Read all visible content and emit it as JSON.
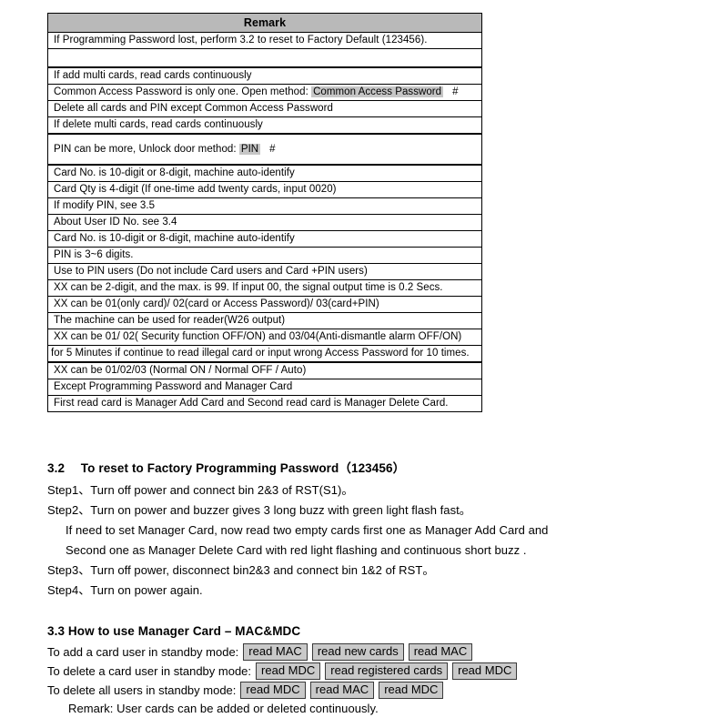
{
  "table": {
    "header": "Remark",
    "rows": [
      {
        "kind": "text",
        "text": "If Programming Password lost, perform 3.2 to reset to Factory Default (123456)."
      },
      {
        "kind": "empty",
        "text": ""
      },
      {
        "kind": "text",
        "text": "If add multi cards, read cards continuously",
        "group_start": true
      },
      {
        "kind": "highlight",
        "prefix": "Common Access Password is only one.  Open method: ",
        "highlight": "Common Access Password",
        "suffix": "#"
      },
      {
        "kind": "text",
        "text": "Delete all cards and PIN except Common Access Password"
      },
      {
        "kind": "text",
        "text": "If delete multi cards, read cards continuously",
        "group_end": true
      },
      {
        "kind": "highlight",
        "prefix": "PIN can be more, Unlock door method: ",
        "highlight": "PIN",
        "suffix": "#",
        "tall": true
      },
      {
        "kind": "text",
        "text": "Card No. is 10-digit or 8-digit, machine auto-identify",
        "group_start": true
      },
      {
        "kind": "text",
        "text": "Card Qty is 4-digit (If one-time add twenty cards, input 0020)"
      },
      {
        "kind": "text",
        "text": "If modify PIN, see 3.5"
      },
      {
        "kind": "text",
        "text": "About User ID No. see 3.4"
      },
      {
        "kind": "text",
        "text": "Card No. is 10-digit or 8-digit, machine auto-identify"
      },
      {
        "kind": "text",
        "text": "PIN is 3~6 digits."
      },
      {
        "kind": "text",
        "text": "Use to PIN users (Do not include Card users and Card +PIN users)"
      },
      {
        "kind": "text",
        "text": "XX can be 2-digit, and the max. is 99. If input 00, the signal output time is 0.2 Secs."
      },
      {
        "kind": "text",
        "text": "XX can be 01(only card)/ 02(card or Access Password)/ 03(card+PIN)"
      },
      {
        "kind": "text",
        "text": "The machine can be used for reader(W26 output)"
      },
      {
        "kind": "text",
        "text": "XX can be 01/ 02( Security function OFF/ON) and 03/04(Anti-dismantle alarm OFF/ON)"
      },
      {
        "kind": "flush",
        "text": "for 5 Minutes if continue to read illegal card or input wrong Access Password for 10 times."
      },
      {
        "kind": "text",
        "text": "XX can be 01/02/03  (Normal ON    / Normal OFF /    Auto)",
        "group_start": true
      },
      {
        "kind": "text",
        "text": "Except Programming Password and Manager Card"
      },
      {
        "kind": "text",
        "text": "First read card is Manager Add Card and Second read card is Manager Delete Card."
      }
    ]
  },
  "section32": {
    "number": "3.2",
    "title": "To reset to Factory Programming Password（123456）",
    "steps": [
      "Step1、Turn off power and connect bin 2&3 of RST(S1)。",
      "Step2、Turn on power and buzzer gives 3 long buzz with green light flash fast。",
      "If need to set Manager Card, now read two empty cards first one as Manager Add Card and",
      "Second one as Manager Delete Card with red light flashing and continuous short buzz .",
      "Step3、Turn off power, disconnect bin2&3 and connect bin 1&2 of RST。",
      "Step4、Turn on power again."
    ]
  },
  "section33": {
    "heading": "3.3 How to use Manager Card – MAC&MDC",
    "procedures": [
      {
        "label": "To add a card user in standby mode:",
        "keys": [
          "read MAC",
          "read new cards",
          "read MAC"
        ]
      },
      {
        "label": "To delete a card user in standby mode:",
        "keys": [
          "read MDC",
          "read registered cards",
          "read MDC"
        ]
      },
      {
        "label": "To delete all users in standby mode:",
        "keys": [
          "read MDC",
          "read MAC",
          "read MDC"
        ]
      }
    ],
    "remark": "Remark: User cards can be added or deleted continuously."
  },
  "colors": {
    "header_fill": "#b9b9b9",
    "highlight_fill": "#c6c6c6",
    "keycap_fill": "#c9c9c9",
    "border": "#000000"
  }
}
